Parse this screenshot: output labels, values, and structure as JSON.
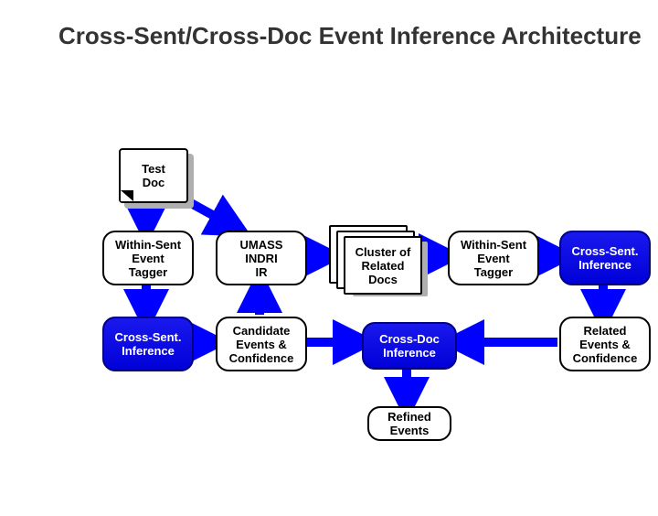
{
  "title": "Cross-Sent/Cross-Doc Event Inference Architecture",
  "boxes": {
    "testDoc": "Test\nDoc",
    "wsTagger1": "Within-Sent\nEvent\nTagger",
    "umass": "UMASS\nINDRI\nIR",
    "cluster": "Cluster of\nRelated\nDocs",
    "wsTagger2": "Within-Sent\nEvent\nTagger",
    "crossSent1": "Cross-Sent.\nInference",
    "crossSent2": "Cross-Sent.\nInference",
    "candidate": "Candidate\nEvents &\nConfidence",
    "crossDoc": "Cross-Doc\nInference",
    "related": "Related\nEvents &\nConfidence",
    "refined": "Refined\nEvents"
  },
  "chart_data": {
    "type": "flowchart",
    "nodes": [
      {
        "id": "testDoc",
        "label": "Test Doc",
        "kind": "document"
      },
      {
        "id": "wsTagger1",
        "label": "Within-Sent Event Tagger",
        "kind": "process"
      },
      {
        "id": "umass",
        "label": "UMASS INDRI IR",
        "kind": "process"
      },
      {
        "id": "cluster",
        "label": "Cluster of Related Docs",
        "kind": "documents"
      },
      {
        "id": "wsTagger2",
        "label": "Within-Sent Event Tagger",
        "kind": "process"
      },
      {
        "id": "crossSent1",
        "label": "Cross-Sent. Inference",
        "kind": "process-highlight"
      },
      {
        "id": "crossSent2",
        "label": "Cross-Sent. Inference",
        "kind": "process-highlight"
      },
      {
        "id": "candidate",
        "label": "Candidate Events & Confidence",
        "kind": "data"
      },
      {
        "id": "crossDoc",
        "label": "Cross-Doc Inference",
        "kind": "process-highlight"
      },
      {
        "id": "related",
        "label": "Related Events & Confidence",
        "kind": "data"
      },
      {
        "id": "refined",
        "label": "Refined Events",
        "kind": "result"
      }
    ],
    "edges": [
      [
        "testDoc",
        "wsTagger1"
      ],
      [
        "testDoc",
        "umass"
      ],
      [
        "wsTagger1",
        "crossSent1"
      ],
      [
        "crossSent1",
        "candidate"
      ],
      [
        "candidate",
        "umass"
      ],
      [
        "umass",
        "cluster"
      ],
      [
        "cluster",
        "wsTagger2"
      ],
      [
        "wsTagger2",
        "crossSent2"
      ],
      [
        "crossSent2",
        "related"
      ],
      [
        "related",
        "crossDoc"
      ],
      [
        "candidate",
        "crossDoc"
      ],
      [
        "crossDoc",
        "refined"
      ]
    ]
  }
}
